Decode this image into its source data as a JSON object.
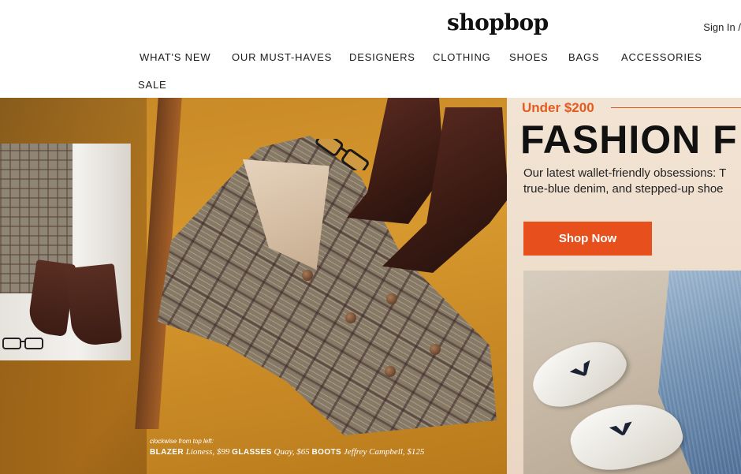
{
  "header": {
    "logo": "shopbop",
    "signin": "Sign In /"
  },
  "nav": {
    "items": [
      "WHAT'S NEW",
      "OUR MUST-HAVES",
      "DESIGNERS",
      "CLOTHING",
      "SHOES",
      "BAGS",
      "ACCESSORIES",
      "SALE"
    ]
  },
  "hero": {
    "caption_small": "clockwise from top left:",
    "caption": {
      "item1_label": "BLAZER",
      "item1_brand": "Lioness, $99",
      "item2_label": "GLASSES",
      "item2_brand": "Quay, $65",
      "item3_label": "BOOTS",
      "item3_brand": "Jeffrey Campbell, $125"
    }
  },
  "promo": {
    "eyebrow": "Under $200",
    "title": "FASHION F",
    "body_line1": "Our latest wallet-friendly obsessions: T",
    "body_line2": "true-blue denim, and stepped-up shoe",
    "cta": "Shop Now"
  },
  "colors": {
    "accent": "#e7501d",
    "eyebrow": "#e35b1e"
  }
}
